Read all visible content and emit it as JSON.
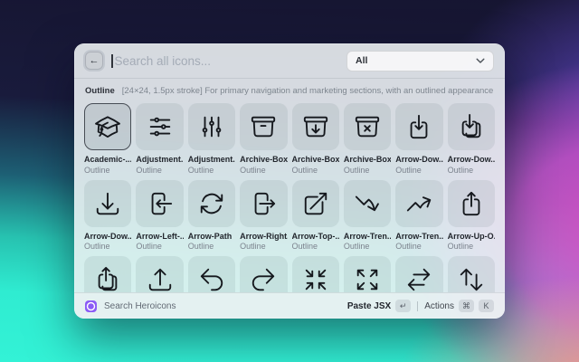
{
  "search": {
    "placeholder": "Search all icons...",
    "back_icon_glyph": "←"
  },
  "filter": {
    "value": "All"
  },
  "section": {
    "title": "Outline",
    "description": "[24×24, 1.5px stroke] For primary navigation and marketing sections, with an outlined appearance."
  },
  "grid": {
    "items": [
      {
        "label": "Academic-...",
        "sublabel": "Outline",
        "icon": "academic-cap-icon",
        "selected": true
      },
      {
        "label": "Adjustment...",
        "sublabel": "Outline",
        "icon": "adjustments-horizontal-icon"
      },
      {
        "label": "Adjustment...",
        "sublabel": "Outline",
        "icon": "adjustments-vertical-icon"
      },
      {
        "label": "Archive-Box",
        "sublabel": "Outline",
        "icon": "archive-box-icon"
      },
      {
        "label": "Archive-Box...",
        "sublabel": "Outline",
        "icon": "archive-box-arrow-down-icon"
      },
      {
        "label": "Archive-Box...",
        "sublabel": "Outline",
        "icon": "archive-box-x-mark-icon"
      },
      {
        "label": "Arrow-Dow...",
        "sublabel": "Outline",
        "icon": "arrow-down-on-square-icon"
      },
      {
        "label": "Arrow-Dow...",
        "sublabel": "Outline",
        "icon": "arrow-down-on-square-stack-icon"
      },
      {
        "label": "Arrow-Dow...",
        "sublabel": "Outline",
        "icon": "arrow-down-tray-icon"
      },
      {
        "label": "Arrow-Left-...",
        "sublabel": "Outline",
        "icon": "arrow-left-on-rectangle-icon"
      },
      {
        "label": "Arrow-Path",
        "sublabel": "Outline",
        "icon": "arrow-path-icon"
      },
      {
        "label": "Arrow-Right...",
        "sublabel": "Outline",
        "icon": "arrow-right-on-rectangle-icon"
      },
      {
        "label": "Arrow-Top-...",
        "sublabel": "Outline",
        "icon": "arrow-top-right-on-square-icon"
      },
      {
        "label": "Arrow-Tren...",
        "sublabel": "Outline",
        "icon": "arrow-trending-down-icon"
      },
      {
        "label": "Arrow-Tren...",
        "sublabel": "Outline",
        "icon": "arrow-trending-up-icon"
      },
      {
        "label": "Arrow-Up-O...",
        "sublabel": "Outline",
        "icon": "arrow-up-on-square-icon"
      },
      {
        "label": "",
        "sublabel": "",
        "icon": "arrow-up-on-square-stack-icon"
      },
      {
        "label": "",
        "sublabel": "",
        "icon": "arrow-up-tray-icon"
      },
      {
        "label": "",
        "sublabel": "",
        "icon": "arrow-uturn-left-icon"
      },
      {
        "label": "",
        "sublabel": "",
        "icon": "arrow-uturn-right-icon"
      },
      {
        "label": "",
        "sublabel": "",
        "icon": "arrows-pointing-in-icon"
      },
      {
        "label": "",
        "sublabel": "",
        "icon": "arrows-pointing-out-icon"
      },
      {
        "label": "",
        "sublabel": "",
        "icon": "arrows-right-left-icon"
      },
      {
        "label": "",
        "sublabel": "",
        "icon": "arrows-up-down-icon"
      }
    ]
  },
  "footer": {
    "app_label": "Search Heroicons",
    "primary_action": "Paste JSX",
    "primary_key": "↵",
    "actions_label": "Actions",
    "actions_keys": [
      "⌘",
      "K"
    ]
  },
  "colors": {
    "brand_purple": "#8b5cf6",
    "selection_border": "#474d55",
    "bg_navy": "#161531",
    "bg_teal": "#2fecd1",
    "bg_pink": "#e64ec8"
  }
}
